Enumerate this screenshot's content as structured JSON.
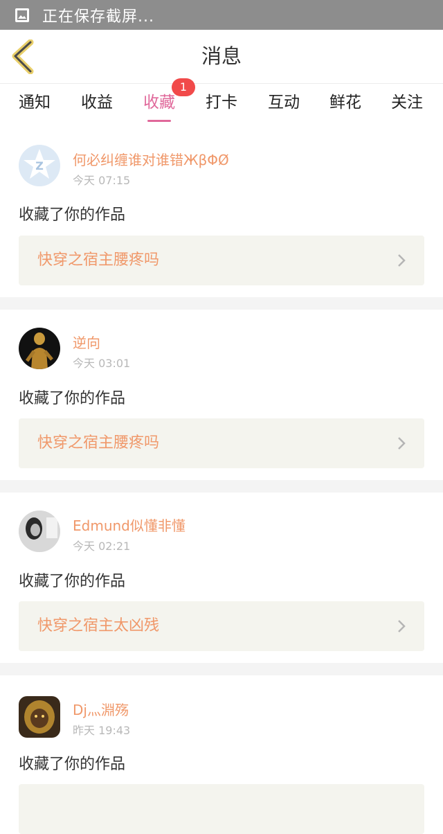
{
  "status_bar": {
    "text": "正在保存截屏..."
  },
  "header": {
    "title": "消息"
  },
  "tabs": [
    {
      "label": "通知"
    },
    {
      "label": "收益"
    },
    {
      "label": "收藏",
      "badge": "1"
    },
    {
      "label": "打卡"
    },
    {
      "label": "互动"
    },
    {
      "label": "鲜花"
    },
    {
      "label": "关注"
    }
  ],
  "active_tab": "收藏",
  "colors": {
    "accent": "#e0689a",
    "username": "#f0986a",
    "badge": "#f14a4a",
    "card_bg": "#f4f4ee"
  },
  "messages": [
    {
      "username": "何必纠缠谁对谁错ЖβΦØ",
      "time": "今天 07:15",
      "action": "收藏了你的作品",
      "work_title": "快穿之宿主腰疼吗",
      "avatar": "default-avatar-icon"
    },
    {
      "username": "逆向",
      "time": "今天 03:01",
      "action": "收藏了你的作品",
      "work_title": "快穿之宿主腰疼吗",
      "avatar": "golden-figure-avatar"
    },
    {
      "username": "Edmund似懂非懂",
      "time": "今天 02:21",
      "action": "收藏了你的作品",
      "work_title": "快穿之宿主太凶残",
      "avatar": "bw-portrait-avatar"
    },
    {
      "username": "Dj灬淵殇",
      "time": "昨天 19:43",
      "action": "收藏了你的作品",
      "work_title": "",
      "avatar": "armored-warrior-avatar"
    }
  ]
}
